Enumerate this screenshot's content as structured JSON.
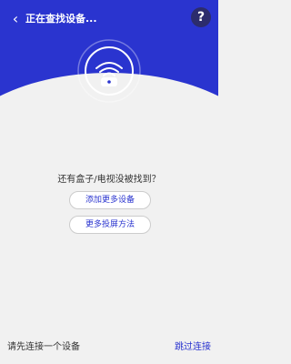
{
  "header": {
    "title": "正在查找设备...",
    "help_label": "?"
  },
  "main": {
    "prompt": "还有盒子/电视没被找到？",
    "buttons": [
      {
        "label": "添加更多设备"
      },
      {
        "label": "更多投屏方法"
      }
    ]
  },
  "footer": {
    "left_text": "请先连接一个设备",
    "right_link": "跳过连接"
  },
  "colors": {
    "accent": "#2a34cf",
    "background": "#f1f1f1"
  },
  "icons": {
    "back": "chevron-left-icon",
    "help": "question-icon",
    "radar": "wifi-tv-icon"
  }
}
